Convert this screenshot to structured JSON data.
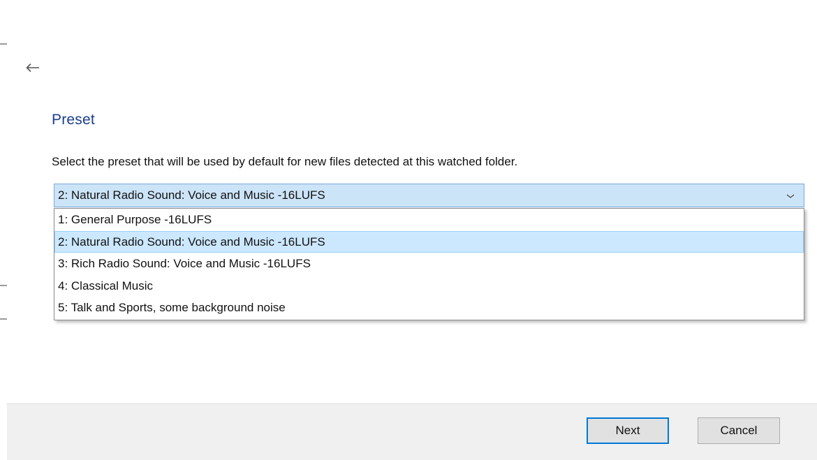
{
  "header": {
    "back_icon": "back-arrow-icon"
  },
  "page": {
    "title": "Preset",
    "description": "Select the preset that will be used by default for new files detected at this watched folder."
  },
  "preset_select": {
    "selected_value": "2: Natural Radio Sound: Voice and Music -16LUFS",
    "arrow_icon": "chevron-down-icon",
    "options": [
      "1: General Purpose -16LUFS",
      "2: Natural Radio Sound: Voice and Music -16LUFS",
      "3: Rich Radio Sound: Voice and Music -16LUFS",
      "4: Classical Music",
      "5: Talk and Sports, some background noise"
    ],
    "selected_index": 1
  },
  "footer": {
    "next_label": "Next",
    "cancel_label": "Cancel"
  },
  "colors": {
    "accent": "#0078d7",
    "title": "#1a3d8f",
    "selection": "#cce8ff"
  }
}
